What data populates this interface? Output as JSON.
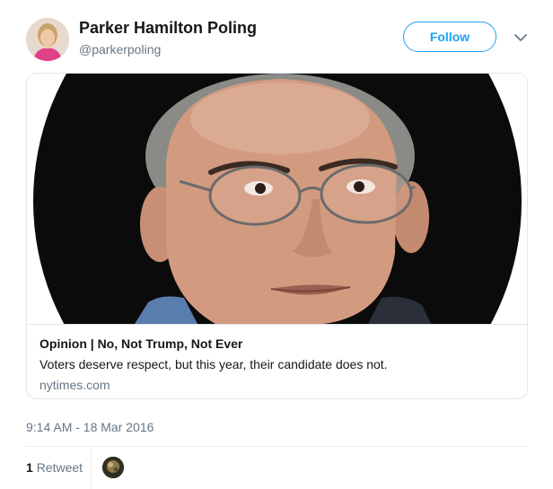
{
  "tweet": {
    "display_name": "Parker Hamilton Poling",
    "handle": "@parkerpoling",
    "follow_label": "Follow",
    "timestamp": "9:14 AM - 18 Mar 2016"
  },
  "card": {
    "title": "Opinion | No, Not Trump, Not Ever",
    "description": "Voters deserve respect, but this year, their candidate does not.",
    "domain": "nytimes.com"
  },
  "stats": {
    "retweet_count": "1",
    "retweet_label": "Retweet"
  },
  "colors": {
    "accent": "#1da1f2",
    "secondary_text": "#657786"
  },
  "icons": {
    "caret": "chevron-down-icon"
  }
}
